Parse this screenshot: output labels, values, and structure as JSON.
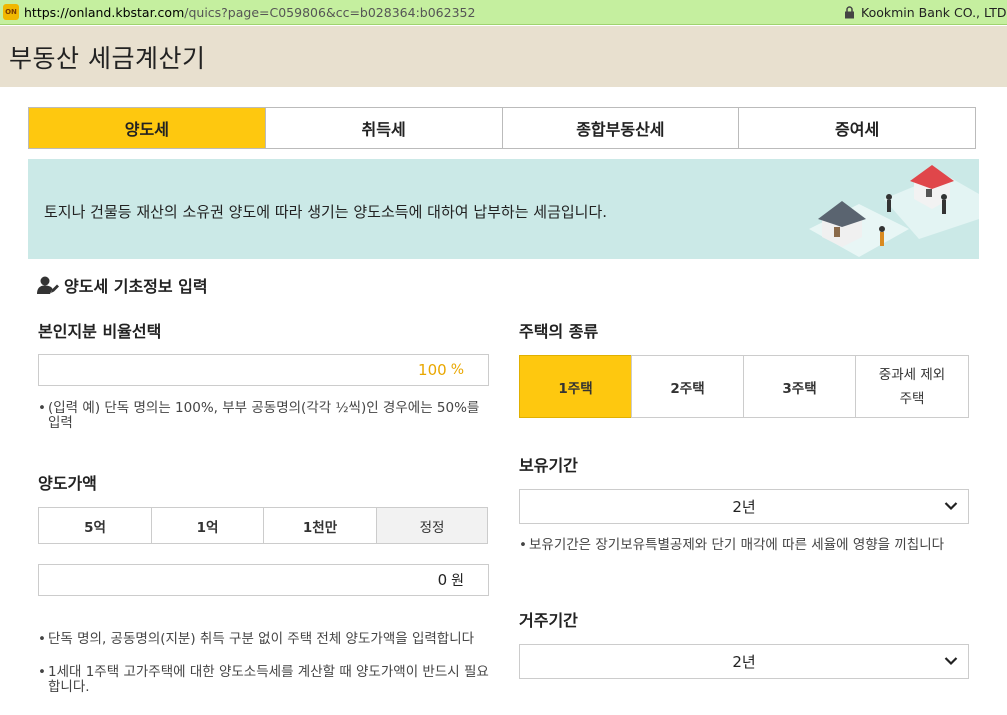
{
  "browser": {
    "favicon_text": "ON",
    "url_host": "https://onland.kbstar.com",
    "url_rest": "/quics?page=C059806&cc=b028364:b062352",
    "cert_text": "Kookmin Bank CO., LTD. [K"
  },
  "header": {
    "title": "부동산 세금계산기"
  },
  "tabs": [
    {
      "label": "양도세",
      "active": true
    },
    {
      "label": "취득세",
      "active": false
    },
    {
      "label": "종합부동산세",
      "active": false
    },
    {
      "label": "증여세",
      "active": false
    }
  ],
  "banner": {
    "description": "토지나 건물등 재산의 소유권 양도에 따라 생기는 양도소득에 대하여 납부하는 세금입니다."
  },
  "section": {
    "title": "양도세 기초정보 입력",
    "icon": "user-edit-icon"
  },
  "ownership": {
    "label": "본인지분 비율선택",
    "value": "100",
    "unit": "%",
    "note": "(입력 예) 단독 명의는 100%, 부부 공동명의(각각 ½씩)인 경우에는 50%를 입력"
  },
  "sale_price": {
    "label": "양도가액",
    "buttons": [
      "5억",
      "1억",
      "1천만",
      "정정"
    ],
    "value": "0",
    "unit": "원",
    "notes": [
      "단독 명의, 공동명의(지분) 취득 구분 없이 주택 전체 양도가액을 입력합니다",
      "1세대 1주택 고가주택에 대한 양도소득세를 계산할 때 양도가액이 반드시 필요합니다."
    ]
  },
  "house_type": {
    "label": "주택의 종류",
    "options": [
      {
        "label": "1주택",
        "active": true
      },
      {
        "label": "2주택",
        "active": false
      },
      {
        "label": "3주택",
        "active": false
      },
      {
        "label": "중과세 제외 주택",
        "active": false
      }
    ]
  },
  "holding_period": {
    "label": "보유기간",
    "selected": "2년",
    "note": "보유기간은 장기보유특별공제와 단기 매각에 따른 세율에 영향을 끼칩니다"
  },
  "residence_period": {
    "label": "거주기간",
    "selected": "2년"
  },
  "colors": {
    "accent": "#fec80f",
    "header_bg": "#e8e0cf",
    "banner_bg": "#cbe9e7",
    "urlbar_bg": "#c5ef9f",
    "value_orange": "#e9a700"
  }
}
